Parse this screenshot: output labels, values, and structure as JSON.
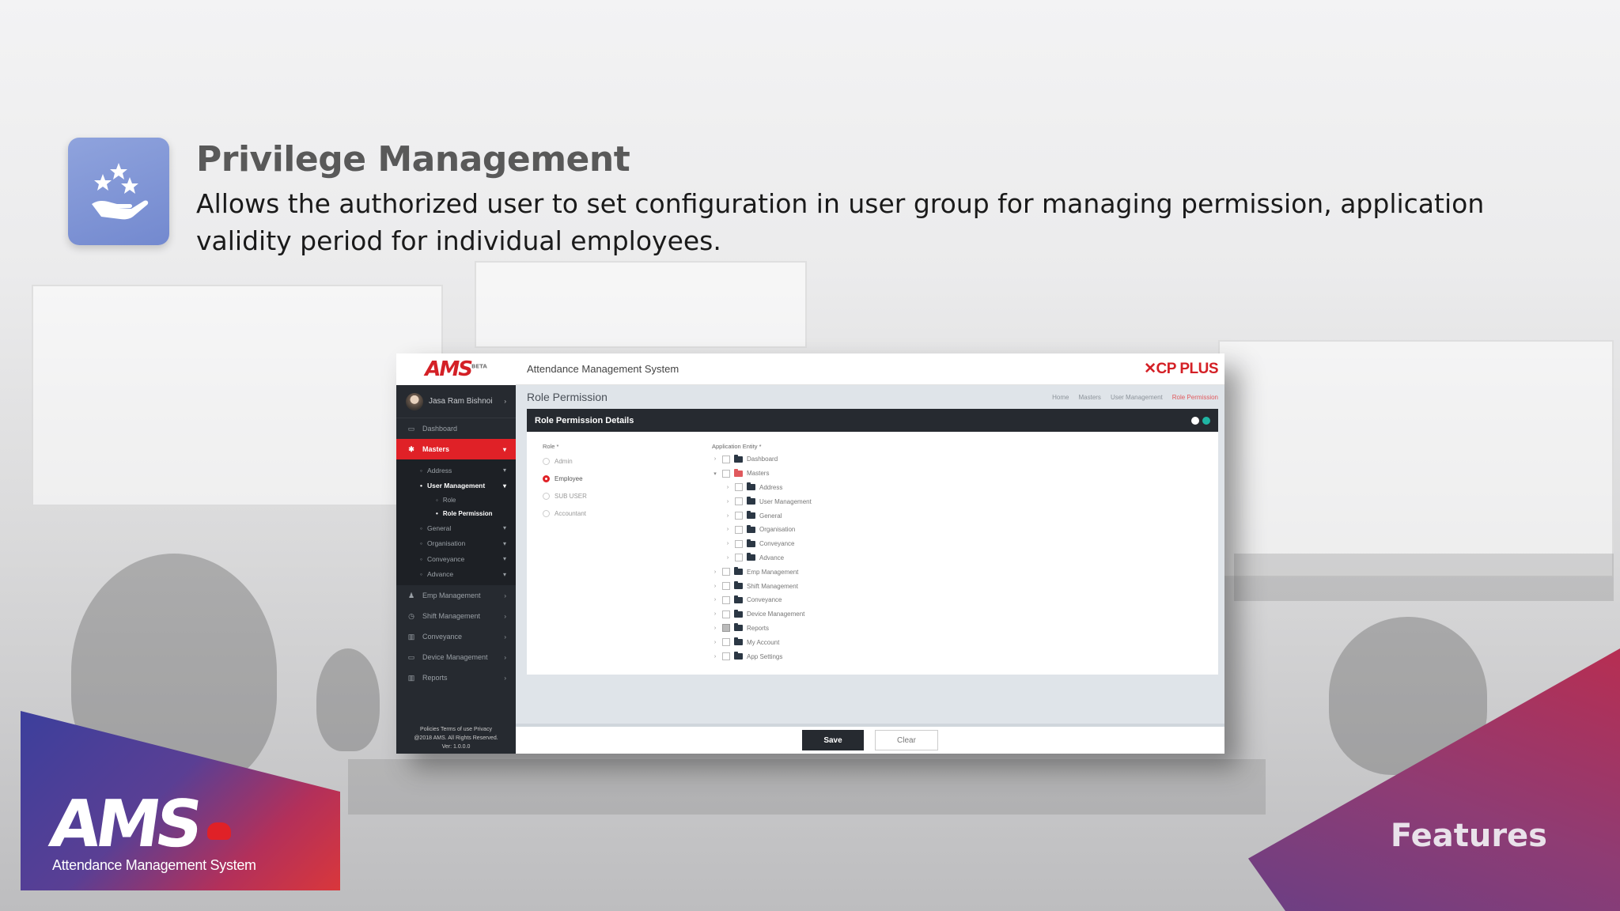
{
  "slide": {
    "title": "Privilege Management",
    "description": "Allows the authorized user to set configuration in user group for managing permission, application validity period for individual employees.",
    "icon": "stars-hand-icon",
    "features_label": "Features",
    "ams_logo_text": "AMS",
    "ams_tagline": "Attendance Management System",
    "colors": {
      "brand_red": "#e02127",
      "icon_blue": "#7c91d4",
      "features_purple": "#8e3c74"
    }
  },
  "app": {
    "logo": "AMS",
    "logo_sup": "BETA",
    "title": "Attendance Management System",
    "brand": "CP PLUS",
    "user_name": "Jasa Ram Bishnoi",
    "sidebar": {
      "top_items": [
        {
          "label": "Dashboard",
          "icon": "monitor-icon"
        },
        {
          "label": "Masters",
          "icon": "gear-icon"
        }
      ],
      "masters_sub": [
        {
          "label": "Address"
        },
        {
          "label": "User Management"
        }
      ],
      "user_mgmt_sub": [
        {
          "label": "Role"
        },
        {
          "label": "Role Permission"
        }
      ],
      "masters_sub_rest": [
        {
          "label": "General"
        },
        {
          "label": "Organisation"
        },
        {
          "label": "Conveyance"
        },
        {
          "label": "Advance"
        }
      ],
      "bottom_items": [
        {
          "label": "Emp Management",
          "icon": "person-icon"
        },
        {
          "label": "Shift Management",
          "icon": "clock-icon"
        },
        {
          "label": "Conveyance",
          "icon": "bar-chart-icon"
        },
        {
          "label": "Device Management",
          "icon": "monitor-icon"
        },
        {
          "label": "Reports",
          "icon": "bar-chart-icon"
        }
      ],
      "footer_links": "Policies   Terms of use   Privacy",
      "footer_copyright": "@2018 AMS. All Rights Reserved.",
      "footer_version": "Ver: 1.0.0.0"
    },
    "page_heading": "Role Permission",
    "breadcrumb": [
      "Home",
      "Masters",
      "User Management",
      "Role Permission"
    ],
    "panel_title": "Role Permission Details",
    "role_label": "Role *",
    "roles": [
      {
        "label": "Admin",
        "selected": false
      },
      {
        "label": "Employee",
        "selected": true
      },
      {
        "label": "SUB USER",
        "selected": false
      },
      {
        "label": "Accountant",
        "selected": false
      }
    ],
    "entity_label": "Application Entity *",
    "entities": [
      {
        "label": "Dashboard",
        "level": 0,
        "toggle": "›",
        "state": "none",
        "open": false
      },
      {
        "label": "Masters",
        "level": 0,
        "toggle": "▾",
        "state": "none",
        "open": true
      },
      {
        "label": "Address",
        "level": 1,
        "toggle": "›",
        "state": "none",
        "open": false
      },
      {
        "label": "User Management",
        "level": 1,
        "toggle": "›",
        "state": "none",
        "open": false
      },
      {
        "label": "General",
        "level": 1,
        "toggle": "›",
        "state": "none",
        "open": false
      },
      {
        "label": "Organisation",
        "level": 1,
        "toggle": "›",
        "state": "none",
        "open": false
      },
      {
        "label": "Conveyance",
        "level": 1,
        "toggle": "›",
        "state": "none",
        "open": false
      },
      {
        "label": "Advance",
        "level": 1,
        "toggle": "›",
        "state": "none",
        "open": false
      },
      {
        "label": "Emp Management",
        "level": 0,
        "toggle": "›",
        "state": "none",
        "open": false
      },
      {
        "label": "Shift Management",
        "level": 0,
        "toggle": "›",
        "state": "none",
        "open": false
      },
      {
        "label": "Conveyance",
        "level": 0,
        "toggle": "›",
        "state": "none",
        "open": false
      },
      {
        "label": "Device Management",
        "level": 0,
        "toggle": "›",
        "state": "none",
        "open": false
      },
      {
        "label": "Reports",
        "level": 0,
        "toggle": "›",
        "state": "partial",
        "open": false
      },
      {
        "label": "My Account",
        "level": 0,
        "toggle": "›",
        "state": "none",
        "open": false
      },
      {
        "label": "App Settings",
        "level": 0,
        "toggle": "›",
        "state": "none",
        "open": false
      }
    ],
    "save_label": "Save",
    "clear_label": "Clear"
  }
}
